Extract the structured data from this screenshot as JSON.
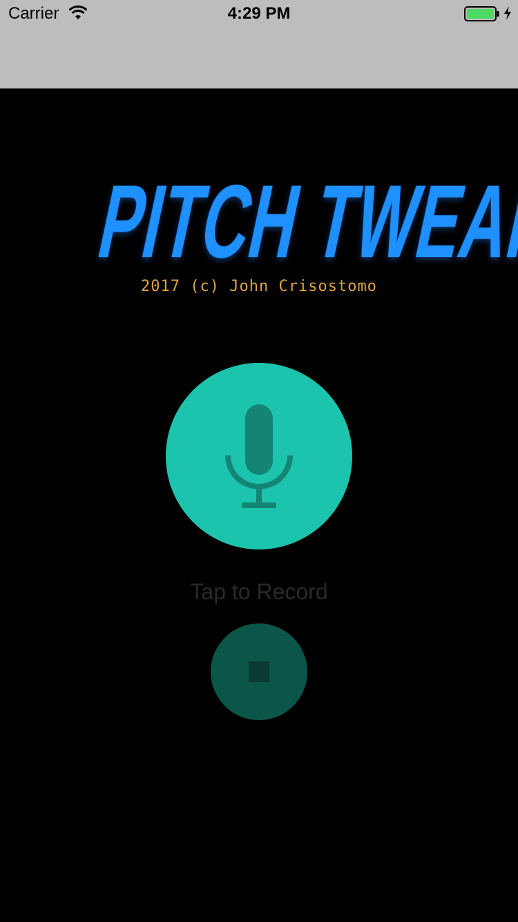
{
  "status_bar": {
    "carrier": "Carrier",
    "time": "4:29 PM",
    "wifi_icon": "wifi-icon",
    "battery_icon": "battery-icon",
    "charging_icon": "bolt-icon",
    "battery_color": "#4cd964"
  },
  "logo": {
    "title": "PITCH TWEAKER",
    "copyright": "2017 (c) John Crisostomo",
    "title_color": "#1e90ff",
    "copyright_color": "#e0a43a"
  },
  "record": {
    "icon": "microphone-icon",
    "label": "Tap to Record",
    "color": "#1cc4ae"
  },
  "stop": {
    "icon": "stop-icon",
    "color": "#0b5549"
  }
}
